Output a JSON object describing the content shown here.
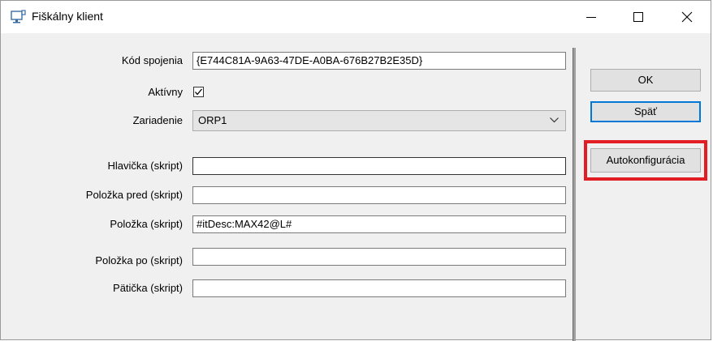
{
  "window": {
    "title": "Fiškálny klient"
  },
  "form": {
    "kod_spojenia": {
      "label": "Kód spojenia",
      "value": "{E744C81A-9A63-47DE-A0BA-676B27B2E35D}"
    },
    "aktivny": {
      "label": "Aktívny",
      "checked": true
    },
    "zariadenie": {
      "label": "Zariadenie",
      "value": "ORP1"
    },
    "hlavicka": {
      "label": "Hlavička (skript)",
      "value": ""
    },
    "polozka_pred": {
      "label": "Položka pred (skript)",
      "value": ""
    },
    "polozka": {
      "label": "Položka (skript)",
      "value": "#itDesc:MAX42@L#"
    },
    "polozka_po": {
      "label": "Položka po (skript)",
      "value": ""
    },
    "paticka": {
      "label": "Pätička (skript)",
      "value": ""
    }
  },
  "buttons": {
    "ok": "OK",
    "spat": "Späť",
    "autokonfiguracia": "Autokonfigurácia"
  },
  "colors": {
    "highlight": "#e31d24",
    "focus_border": "#0078d7"
  }
}
